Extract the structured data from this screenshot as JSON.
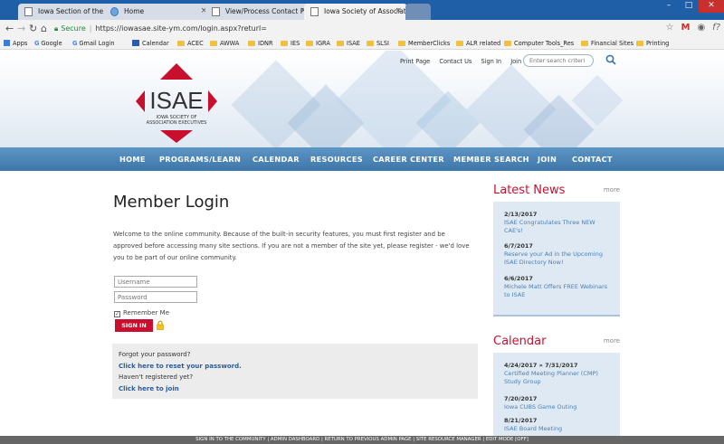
{
  "browser": {
    "tabs": [
      {
        "label": "Iowa Section of the Ame",
        "close": "×"
      },
      {
        "label": "Home",
        "close": "×"
      },
      {
        "label": "View/Process Contact Fo",
        "close": "×"
      },
      {
        "label": "Iowa Society of Associat",
        "close": "×"
      }
    ],
    "url_secure": "Secure",
    "url_sep": "|",
    "url": "https://iowasae.site-ym.com/login.aspx?returl=",
    "bookmarks": [
      "Apps",
      "Google",
      "Gmail Login",
      "Calendar",
      "ACEC",
      "AWWA",
      "IDNR",
      "IES",
      "IGRA",
      "ISAE",
      "SLSI",
      "MemberClicks",
      "ALR related",
      "Computer Tools_Res",
      "Financial Sites",
      "Printing"
    ],
    "colors": {
      "tabbar": "#1f5fa8",
      "chrome": "#f2f2f2"
    }
  },
  "header": {
    "logo_text": "ISAE",
    "logo_sub_1": "IOWA SOCIETY OF",
    "logo_sub_2": "ASSOCIATION EXECUTIVES",
    "top_links": [
      "Print Page",
      "Contact Us",
      "Sign In",
      "Join"
    ],
    "search_placeholder": "Enter search criteri"
  },
  "nav": {
    "items": [
      "HOME",
      "PROGRAMS/LEARN",
      "CALENDAR",
      "RESOURCES",
      "CAREER CENTER",
      "MEMBER SEARCH",
      "JOIN",
      "CONTACT"
    ]
  },
  "login": {
    "title": "Member Login",
    "welcome": "Welcome to the online community. Because of the built-in security features, you must first register and be approved before accessing many site sections. If you are not a member of the site yet, please register - we'd love you to be part of our online community.",
    "username_placeholder": "Username",
    "password_placeholder": "Password",
    "remember_label": "Remember Me",
    "remember_checked": true,
    "signin_label": "SIGN IN",
    "forgot_text": "Forgot your password?",
    "reset_link": "Click here to reset your password.",
    "not_registered": "Haven't registered yet?",
    "join_link": "Click here to join"
  },
  "news": {
    "title": "Latest News",
    "more": "more",
    "items": [
      {
        "date": "2/13/2017",
        "text": "ISAE Congratulates Three NEW CAE's!"
      },
      {
        "date": "6/7/2017",
        "text": "Reserve your Ad in the Upcoming ISAE Directory Now!"
      },
      {
        "date": "6/6/2017",
        "text": "Michele Matt Offers FREE Webinars to ISAE"
      }
    ]
  },
  "calendar": {
    "title": "Calendar",
    "more": "more",
    "items": [
      {
        "date": "4/24/2017 » 7/31/2017",
        "text": "Certified Meeting Planner (CMP) Study Group"
      },
      {
        "date": "7/20/2017",
        "text": "Iowa CUBS Game Outing"
      },
      {
        "date": "8/21/2017",
        "text": "ISAE Board Meeting"
      }
    ]
  },
  "footer": {
    "text": "SIGN IN TO THE COMMUNITY | ADMIN DASHBOARD | RETURN TO PREVIOUS ADMIN PAGE | SITE RESOURCE MANAGER | EDIT MODE [OFF]"
  },
  "theme": {
    "brand_red": "#c8102e",
    "nav_blue": "#4a84b6",
    "link_blue": "#2a5c9a",
    "sidebar_bg": "#dfe9f3"
  }
}
